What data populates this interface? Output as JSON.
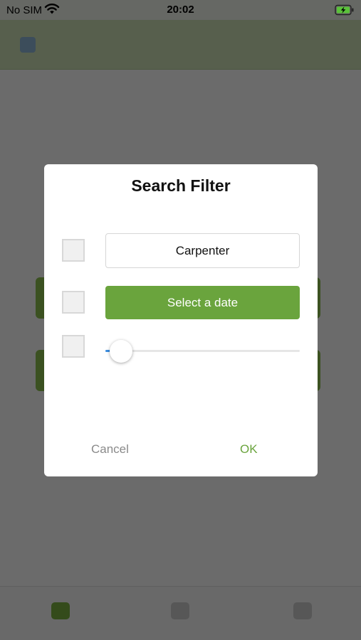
{
  "status_bar": {
    "carrier": "No SIM",
    "time": "20:02",
    "wifi_icon": "wifi-icon",
    "battery_icon": "battery-charging-icon"
  },
  "dialog": {
    "title": "Search Filter",
    "text_field": {
      "value": "Carpenter"
    },
    "date_button_label": "Select a date",
    "slider": {
      "value": 0
    },
    "checkboxes": [
      {
        "checked": false
      },
      {
        "checked": false
      },
      {
        "checked": false
      }
    ],
    "cancel_label": "Cancel",
    "ok_label": "OK"
  },
  "colors": {
    "accent_green": "#6aa43d",
    "slider_blue": "#3d8ee0",
    "cancel_gray": "#8a8a8a"
  }
}
